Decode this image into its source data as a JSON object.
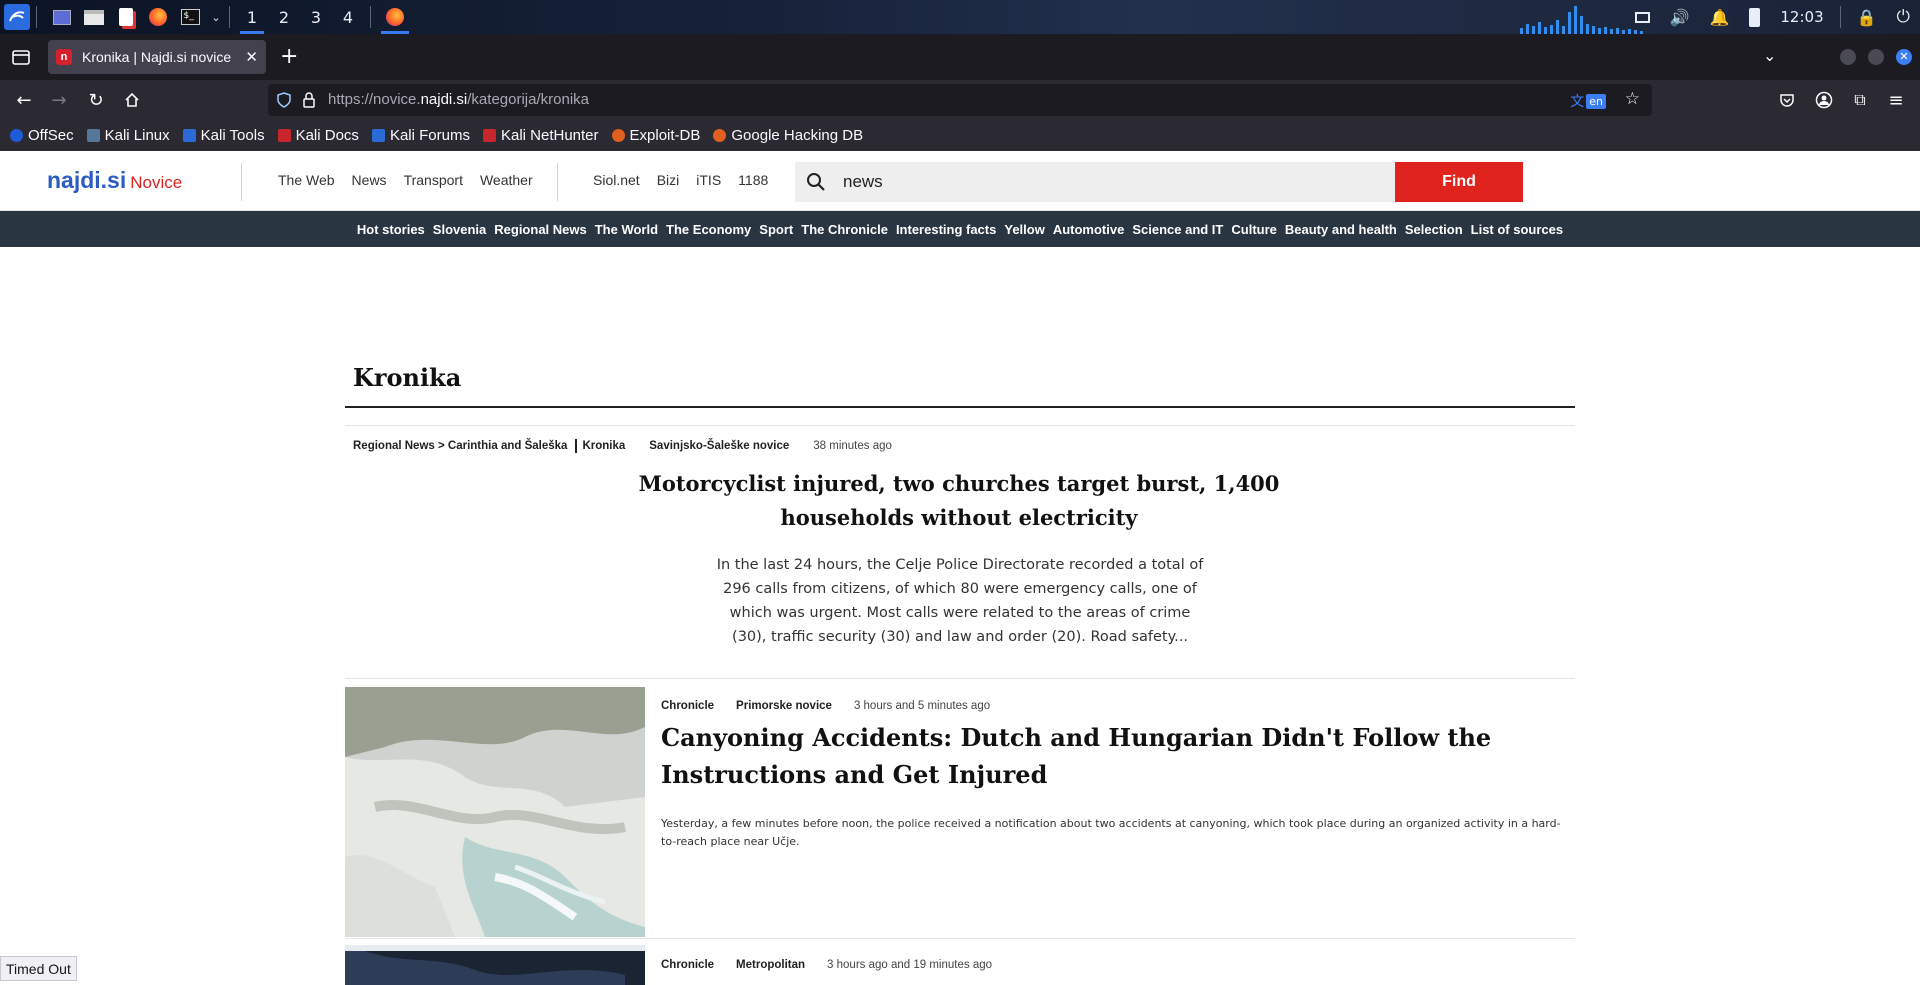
{
  "taskbar": {
    "workspaces": [
      "1",
      "2",
      "3",
      "4"
    ],
    "clock": "12:03"
  },
  "browser": {
    "tab_title": "Kronika | Najdi.si novice",
    "tab_favicon": "n",
    "url_prefix": "https://novice.",
    "url_domain": "najdi.si",
    "url_path": "/kategorija/kronika",
    "translate_lang": "en",
    "bookmarks": [
      {
        "label": "OffSec",
        "color": "#1e5bd8"
      },
      {
        "label": "Kali Linux",
        "color": "#557799"
      },
      {
        "label": "Kali Tools",
        "color": "#2a6bd8"
      },
      {
        "label": "Kali Docs",
        "color": "#c8262c"
      },
      {
        "label": "Kali Forums",
        "color": "#2a6bd8"
      },
      {
        "label": "Kali NetHunter",
        "color": "#c8262c"
      },
      {
        "label": "Exploit-DB",
        "color": "#e06020"
      },
      {
        "label": "Google Hacking DB",
        "color": "#e06020"
      }
    ]
  },
  "site": {
    "logo": "najdi.si",
    "logo_sub": "Novice",
    "links_primary": [
      "The Web",
      "News",
      "Transport",
      "Weather"
    ],
    "links_secondary": [
      "Siol.net",
      "Bizi",
      "iTIS",
      "1188"
    ],
    "search_value": "news",
    "find_label": "Find",
    "categories": [
      "Hot stories",
      "Slovenia",
      "Regional News",
      "The World",
      "The Economy",
      "Sport",
      "The Chronicle",
      "Interesting facts",
      "Yellow",
      "Automotive",
      "Science and IT",
      "Culture",
      "Beauty and health",
      "Selection",
      "List of sources"
    ]
  },
  "page": {
    "section_title": "Kronika",
    "lead": {
      "breadcrumb": "Regional News > Carinthia and Šaleška",
      "category": "Kronika",
      "source": "Savinjsko-Šaleške novice",
      "time": "38 minutes ago",
      "title": "Motorcyclist injured, two churches target burst, 1,400 households without electricity",
      "text": "In the last 24 hours, the Celje Police Directorate recorded a total of 296 calls from citizens, of which 80 were emergency calls, one of which was urgent. Most calls were related to the areas of crime (30), traffic security (30) and law and order (20). Road safety..."
    },
    "stories": [
      {
        "category": "Chronicle",
        "source": "Primorske novice",
        "time": "3 hours and 5 minutes ago",
        "title": "Canyoning Accidents: Dutch and Hungarian Didn't Follow the Instructions and Get Injured",
        "excerpt": "Yesterday, a few minutes before noon, the police received a notification about two accidents at canyoning, which took place during an organized activity in a hard-to-reach place near Učje."
      },
      {
        "category": "Chronicle",
        "source": "Metropolitan",
        "time": "3 hours ago and 19 minutes ago"
      }
    ]
  },
  "status": {
    "timeout": "Timed Out"
  }
}
